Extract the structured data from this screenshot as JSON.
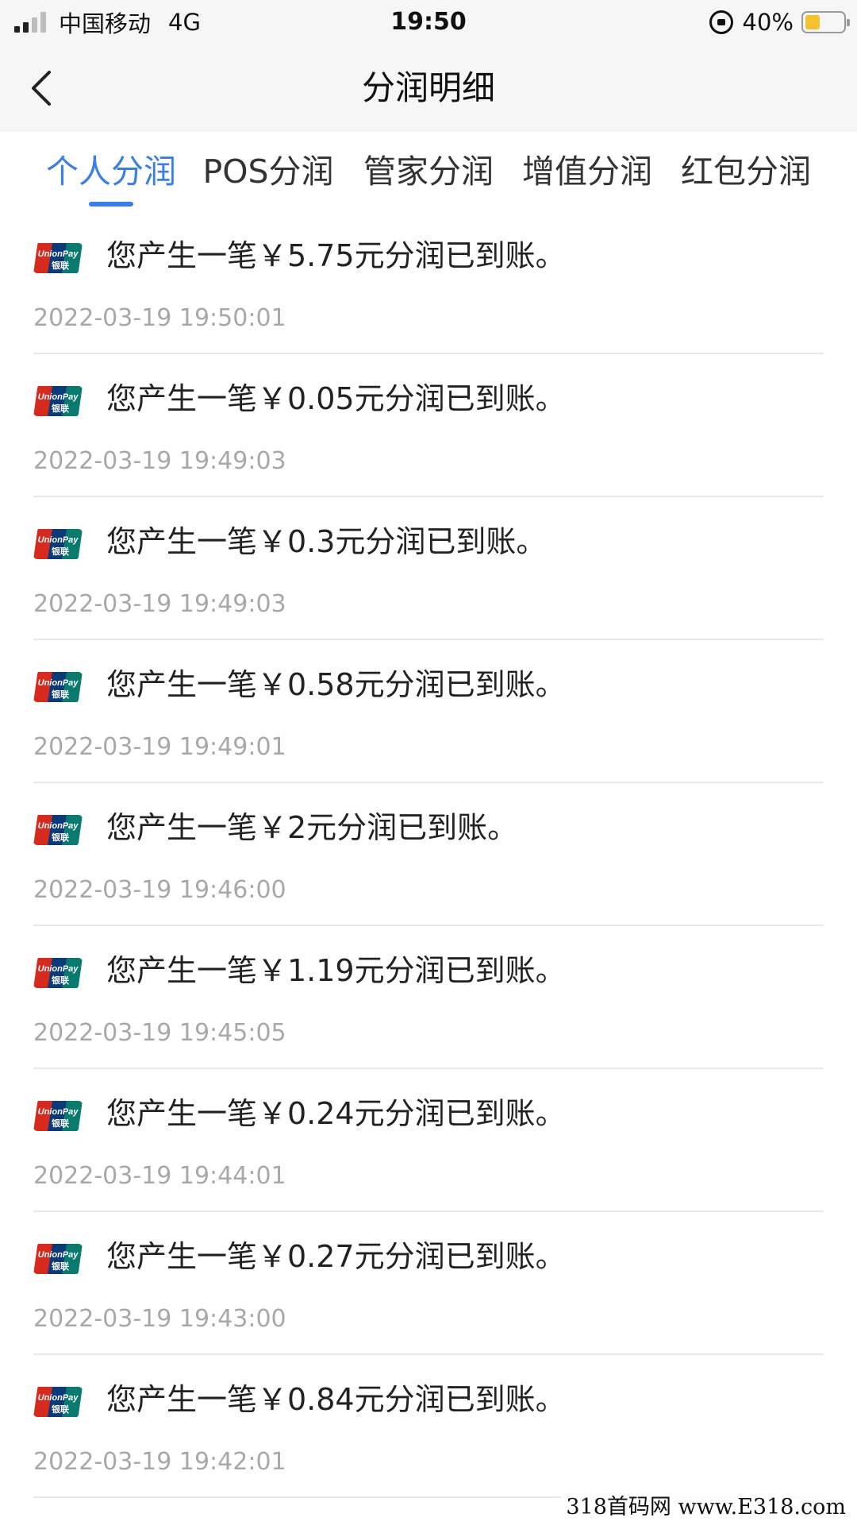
{
  "status_bar": {
    "carrier": "中国移动",
    "network": "4G",
    "time": "19:50",
    "battery_text": "40%",
    "battery_level": 0.4,
    "battery_color": "#f3c22e"
  },
  "nav": {
    "title": "分润明细",
    "back_icon": "chevron-left-icon"
  },
  "tabs": [
    {
      "label": "个人分润",
      "active": true
    },
    {
      "label": "POS分润",
      "active": false
    },
    {
      "label": "管家分润",
      "active": false
    },
    {
      "label": "增值分润",
      "active": false
    },
    {
      "label": "红包分润",
      "active": false
    }
  ],
  "accent_color": "#3a7ee8",
  "records": [
    {
      "text": "您产生一笔￥5.75元分润已到账。",
      "time": "2022-03-19 19:50:01",
      "icon": "unionpay-icon"
    },
    {
      "text": "您产生一笔￥0.05元分润已到账。",
      "time": "2022-03-19 19:49:03",
      "icon": "unionpay-icon"
    },
    {
      "text": "您产生一笔￥0.3元分润已到账。",
      "time": "2022-03-19 19:49:03",
      "icon": "unionpay-icon"
    },
    {
      "text": "您产生一笔￥0.58元分润已到账。",
      "time": "2022-03-19 19:49:01",
      "icon": "unionpay-icon"
    },
    {
      "text": "您产生一笔￥2元分润已到账。",
      "time": "2022-03-19 19:46:00",
      "icon": "unionpay-icon"
    },
    {
      "text": "您产生一笔￥1.19元分润已到账。",
      "time": "2022-03-19 19:45:05",
      "icon": "unionpay-icon"
    },
    {
      "text": "您产生一笔￥0.24元分润已到账。",
      "time": "2022-03-19 19:44:01",
      "icon": "unionpay-icon"
    },
    {
      "text": "您产生一笔￥0.27元分润已到账。",
      "time": "2022-03-19 19:43:00",
      "icon": "unionpay-icon"
    },
    {
      "text": "您产生一笔￥0.84元分润已到账。",
      "time": "2022-03-19 19:42:01",
      "icon": "unionpay-icon"
    }
  ],
  "watermark": "318首码网 www.E318.com"
}
